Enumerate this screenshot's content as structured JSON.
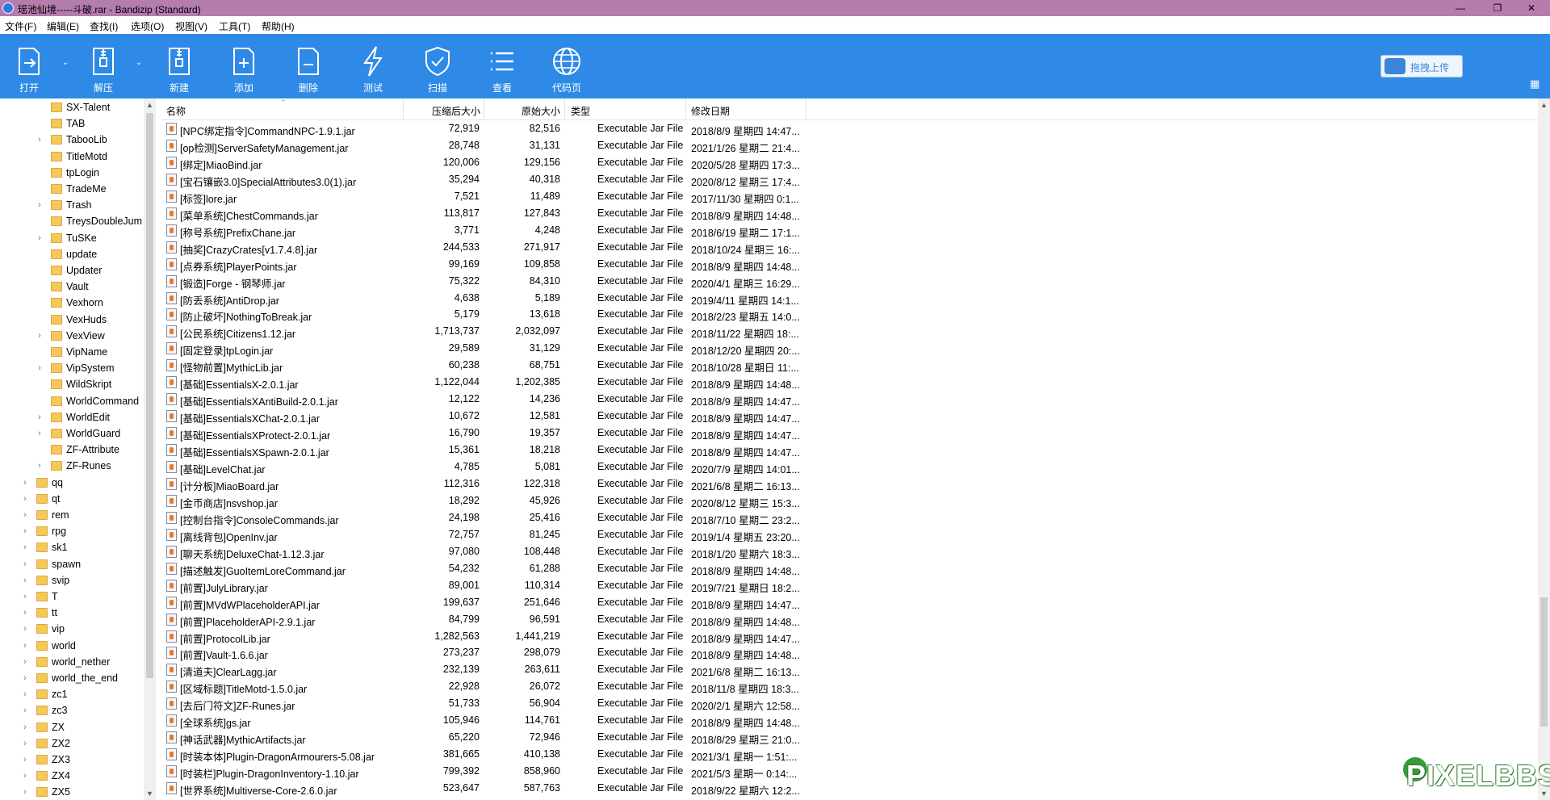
{
  "window": {
    "title": "瑶池仙境-----斗破.rar - Bandizip (Standard)",
    "min": "—",
    "max": "❐",
    "close": "✕"
  },
  "menu": [
    "文件(F)",
    "编辑(E)",
    "查找(I)",
    "选项(O)",
    "视图(V)",
    "工具(T)",
    "帮助(H)"
  ],
  "toolbar": {
    "buttons": [
      {
        "label": "打开",
        "icon": "open-icon"
      },
      {
        "label": "解压",
        "icon": "extract-icon"
      },
      {
        "label": "新建",
        "icon": "new-archive-icon"
      },
      {
        "label": "添加",
        "icon": "add-file-icon"
      },
      {
        "label": "删除",
        "icon": "delete-file-icon"
      },
      {
        "label": "测试",
        "icon": "test-icon"
      },
      {
        "label": "扫描",
        "icon": "shield-icon"
      },
      {
        "label": "查看",
        "icon": "view-list-icon"
      },
      {
        "label": "代码页",
        "icon": "globe-icon"
      }
    ],
    "upload_label": "拖拽上传"
  },
  "tree": [
    {
      "label": "SX-Talent",
      "expandable": false,
      "level": 2
    },
    {
      "label": "TAB",
      "expandable": false,
      "level": 2
    },
    {
      "label": "TabooLib",
      "expandable": true,
      "level": 2
    },
    {
      "label": "TitleMotd",
      "expandable": false,
      "level": 2
    },
    {
      "label": "tpLogin",
      "expandable": false,
      "level": 2
    },
    {
      "label": "TradeMe",
      "expandable": false,
      "level": 2
    },
    {
      "label": "Trash",
      "expandable": true,
      "level": 2
    },
    {
      "label": "TreysDoubleJum",
      "expandable": false,
      "level": 2
    },
    {
      "label": "TuSKe",
      "expandable": true,
      "level": 2
    },
    {
      "label": "update",
      "expandable": false,
      "level": 2
    },
    {
      "label": "Updater",
      "expandable": false,
      "level": 2
    },
    {
      "label": "Vault",
      "expandable": false,
      "level": 2
    },
    {
      "label": "Vexhorn",
      "expandable": false,
      "level": 2
    },
    {
      "label": "VexHuds",
      "expandable": false,
      "level": 2
    },
    {
      "label": "VexView",
      "expandable": true,
      "level": 2
    },
    {
      "label": "VipName",
      "expandable": false,
      "level": 2
    },
    {
      "label": "VipSystem",
      "expandable": true,
      "level": 2
    },
    {
      "label": "WildSkript",
      "expandable": false,
      "level": 2
    },
    {
      "label": "WorldCommand",
      "expandable": false,
      "level": 2
    },
    {
      "label": "WorldEdit",
      "expandable": true,
      "level": 2
    },
    {
      "label": "WorldGuard",
      "expandable": true,
      "level": 2
    },
    {
      "label": "ZF-Attribute",
      "expandable": false,
      "level": 2
    },
    {
      "label": "ZF-Runes",
      "expandable": true,
      "level": 2
    },
    {
      "label": "qq",
      "expandable": true,
      "level": 1
    },
    {
      "label": "qt",
      "expandable": true,
      "level": 1
    },
    {
      "label": "rem",
      "expandable": true,
      "level": 1
    },
    {
      "label": "rpg",
      "expandable": true,
      "level": 1
    },
    {
      "label": "sk1",
      "expandable": true,
      "level": 1
    },
    {
      "label": "spawn",
      "expandable": true,
      "level": 1
    },
    {
      "label": "svip",
      "expandable": true,
      "level": 1
    },
    {
      "label": "T",
      "expandable": true,
      "level": 1
    },
    {
      "label": "tt",
      "expandable": true,
      "level": 1
    },
    {
      "label": "vip",
      "expandable": true,
      "level": 1
    },
    {
      "label": "world",
      "expandable": true,
      "level": 1
    },
    {
      "label": "world_nether",
      "expandable": true,
      "level": 1
    },
    {
      "label": "world_the_end",
      "expandable": true,
      "level": 1
    },
    {
      "label": "zc1",
      "expandable": true,
      "level": 1
    },
    {
      "label": "zc3",
      "expandable": true,
      "level": 1
    },
    {
      "label": "ZX",
      "expandable": true,
      "level": 1
    },
    {
      "label": "ZX2",
      "expandable": true,
      "level": 1
    },
    {
      "label": "ZX3",
      "expandable": true,
      "level": 1
    },
    {
      "label": "ZX4",
      "expandable": true,
      "level": 1
    },
    {
      "label": "ZX5",
      "expandable": true,
      "level": 1
    }
  ],
  "columns": [
    "名称",
    "压缩后大小",
    "原始大小",
    "类型",
    "修改日期"
  ],
  "files": [
    {
      "name": "[NPC绑定指令]CommandNPC-1.9.1.jar",
      "comp": "72,919",
      "orig": "82,516",
      "type": "Executable Jar File",
      "date": "2018/8/9 星期四 14:47..."
    },
    {
      "name": "[op检测]ServerSafetyManagement.jar",
      "comp": "28,748",
      "orig": "31,131",
      "type": "Executable Jar File",
      "date": "2021/1/26 星期二 21:4..."
    },
    {
      "name": "[绑定]MiaoBind.jar",
      "comp": "120,006",
      "orig": "129,156",
      "type": "Executable Jar File",
      "date": "2020/5/28 星期四 17:3..."
    },
    {
      "name": "[宝石镶嵌3.0]SpecialAttributes3.0(1).jar",
      "comp": "35,294",
      "orig": "40,318",
      "type": "Executable Jar File",
      "date": "2020/8/12 星期三 17:4..."
    },
    {
      "name": "[标签]lore.jar",
      "comp": "7,521",
      "orig": "11,489",
      "type": "Executable Jar File",
      "date": "2017/11/30 星期四 0:1..."
    },
    {
      "name": "[菜单系统]ChestCommands.jar",
      "comp": "113,817",
      "orig": "127,843",
      "type": "Executable Jar File",
      "date": "2018/8/9 星期四 14:48..."
    },
    {
      "name": "[称号系统]PrefixChane.jar",
      "comp": "3,771",
      "orig": "4,248",
      "type": "Executable Jar File",
      "date": "2018/6/19 星期二 17:1..."
    },
    {
      "name": "[抽奖]CrazyCrates[v1.7.4.8].jar",
      "comp": "244,533",
      "orig": "271,917",
      "type": "Executable Jar File",
      "date": "2018/10/24 星期三 16:..."
    },
    {
      "name": "[点券系统]PlayerPoints.jar",
      "comp": "99,169",
      "orig": "109,858",
      "type": "Executable Jar File",
      "date": "2018/8/9 星期四 14:48..."
    },
    {
      "name": "[锻造]Forge - 钢琴师.jar",
      "comp": "75,322",
      "orig": "84,310",
      "type": "Executable Jar File",
      "date": "2020/4/1 星期三 16:29..."
    },
    {
      "name": "[防丢系统]AntiDrop.jar",
      "comp": "4,638",
      "orig": "5,189",
      "type": "Executable Jar File",
      "date": "2019/4/11 星期四 14:1..."
    },
    {
      "name": "[防止破坏]NothingToBreak.jar",
      "comp": "5,179",
      "orig": "13,618",
      "type": "Executable Jar File",
      "date": "2018/2/23 星期五 14:0..."
    },
    {
      "name": "[公民系统]Citizens1.12.jar",
      "comp": "1,713,737",
      "orig": "2,032,097",
      "type": "Executable Jar File",
      "date": "2018/11/22 星期四 18:..."
    },
    {
      "name": "[固定登录]tpLogin.jar",
      "comp": "29,589",
      "orig": "31,129",
      "type": "Executable Jar File",
      "date": "2018/12/20 星期四 20:..."
    },
    {
      "name": "[怪物前置]MythicLib.jar",
      "comp": "60,238",
      "orig": "68,751",
      "type": "Executable Jar File",
      "date": "2018/10/28 星期日 11:..."
    },
    {
      "name": "[基础]EssentialsX-2.0.1.jar",
      "comp": "1,122,044",
      "orig": "1,202,385",
      "type": "Executable Jar File",
      "date": "2018/8/9 星期四 14:48..."
    },
    {
      "name": "[基础]EssentialsXAntiBuild-2.0.1.jar",
      "comp": "12,122",
      "orig": "14,236",
      "type": "Executable Jar File",
      "date": "2018/8/9 星期四 14:47..."
    },
    {
      "name": "[基础]EssentialsXChat-2.0.1.jar",
      "comp": "10,672",
      "orig": "12,581",
      "type": "Executable Jar File",
      "date": "2018/8/9 星期四 14:47..."
    },
    {
      "name": "[基础]EssentialsXProtect-2.0.1.jar",
      "comp": "16,790",
      "orig": "19,357",
      "type": "Executable Jar File",
      "date": "2018/8/9 星期四 14:47..."
    },
    {
      "name": "[基础]EssentialsXSpawn-2.0.1.jar",
      "comp": "15,361",
      "orig": "18,218",
      "type": "Executable Jar File",
      "date": "2018/8/9 星期四 14:47..."
    },
    {
      "name": "[基础]LevelChat.jar",
      "comp": "4,785",
      "orig": "5,081",
      "type": "Executable Jar File",
      "date": "2020/7/9 星期四 14:01..."
    },
    {
      "name": "[计分板]MiaoBoard.jar",
      "comp": "112,316",
      "orig": "122,318",
      "type": "Executable Jar File",
      "date": "2021/6/8 星期二 16:13..."
    },
    {
      "name": "[金币商店]nsvshop.jar",
      "comp": "18,292",
      "orig": "45,926",
      "type": "Executable Jar File",
      "date": "2020/8/12 星期三 15:3..."
    },
    {
      "name": "[控制台指令]ConsoleCommands.jar",
      "comp": "24,198",
      "orig": "25,416",
      "type": "Executable Jar File",
      "date": "2018/7/10 星期二 23:2..."
    },
    {
      "name": "[离线背包]OpenInv.jar",
      "comp": "72,757",
      "orig": "81,245",
      "type": "Executable Jar File",
      "date": "2019/1/4 星期五 23:20..."
    },
    {
      "name": "[聊天系统]DeluxeChat-1.12.3.jar",
      "comp": "97,080",
      "orig": "108,448",
      "type": "Executable Jar File",
      "date": "2018/1/20 星期六 18:3..."
    },
    {
      "name": "[描述触发]GuoItemLoreCommand.jar",
      "comp": "54,232",
      "orig": "61,288",
      "type": "Executable Jar File",
      "date": "2018/8/9 星期四 14:48..."
    },
    {
      "name": "[前置]JulyLibrary.jar",
      "comp": "89,001",
      "orig": "110,314",
      "type": "Executable Jar File",
      "date": "2019/7/21 星期日 18:2..."
    },
    {
      "name": "[前置]MVdWPlaceholderAPI.jar",
      "comp": "199,637",
      "orig": "251,646",
      "type": "Executable Jar File",
      "date": "2018/8/9 星期四 14:47..."
    },
    {
      "name": "[前置]PlaceholderAPI-2.9.1.jar",
      "comp": "84,799",
      "orig": "96,591",
      "type": "Executable Jar File",
      "date": "2018/8/9 星期四 14:48..."
    },
    {
      "name": "[前置]ProtocolLib.jar",
      "comp": "1,282,563",
      "orig": "1,441,219",
      "type": "Executable Jar File",
      "date": "2018/8/9 星期四 14:47..."
    },
    {
      "name": "[前置]Vault-1.6.6.jar",
      "comp": "273,237",
      "orig": "298,079",
      "type": "Executable Jar File",
      "date": "2018/8/9 星期四 14:48..."
    },
    {
      "name": "[清道夫]ClearLagg.jar",
      "comp": "232,139",
      "orig": "263,611",
      "type": "Executable Jar File",
      "date": "2021/6/8 星期二 16:13..."
    },
    {
      "name": "[区域标题]TitleMotd-1.5.0.jar",
      "comp": "22,928",
      "orig": "26,072",
      "type": "Executable Jar File",
      "date": "2018/11/8 星期四 18:3..."
    },
    {
      "name": "[去后门符文]ZF-Runes.jar",
      "comp": "51,733",
      "orig": "56,904",
      "type": "Executable Jar File",
      "date": "2020/2/1 星期六 12:58..."
    },
    {
      "name": "[全球系统]gs.jar",
      "comp": "105,946",
      "orig": "114,761",
      "type": "Executable Jar File",
      "date": "2018/8/9 星期四 14:48..."
    },
    {
      "name": "[神话武器]MythicArtifacts.jar",
      "comp": "65,220",
      "orig": "72,946",
      "type": "Executable Jar File",
      "date": "2018/8/29 星期三 21:0..."
    },
    {
      "name": "[时装本体]Plugin-DragonArmourers-5.08.jar",
      "comp": "381,665",
      "orig": "410,138",
      "type": "Executable Jar File",
      "date": "2021/3/1 星期一 1:51:..."
    },
    {
      "name": "[时装栏]Plugin-DragonInventory-1.10.jar",
      "comp": "799,392",
      "orig": "858,960",
      "type": "Executable Jar File",
      "date": "2021/5/3 星期一 0:14:..."
    },
    {
      "name": "[世界系统]Multiverse-Core-2.6.0.jar",
      "comp": "523,647",
      "orig": "587,763",
      "type": "Executable Jar File",
      "date": "2018/9/22 星期六 12:2..."
    }
  ],
  "watermark": "PIXELBBS",
  "colors": {
    "titlebar": "#b57cae",
    "toolbar": "#2e8ae6",
    "folder": "#f5c85a"
  }
}
